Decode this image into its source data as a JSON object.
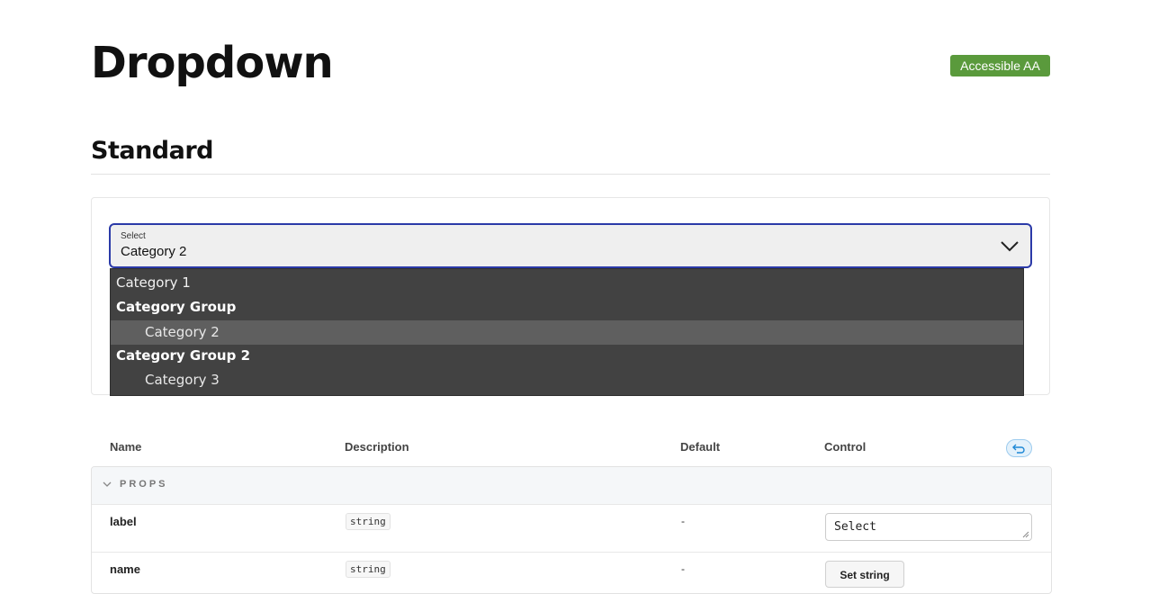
{
  "page": {
    "title": "Dropdown",
    "badge": "Accessible AA",
    "section_title": "Standard"
  },
  "select": {
    "label": "Select",
    "value": "Category 2",
    "options": [
      {
        "label": "Category 1",
        "kind": "option"
      },
      {
        "label": "Category Group",
        "kind": "group"
      },
      {
        "label": "Category 2",
        "kind": "child",
        "selected": true
      },
      {
        "label": "Category Group 2",
        "kind": "group"
      },
      {
        "label": "Category 3",
        "kind": "child"
      }
    ]
  },
  "table": {
    "headers": {
      "name": "Name",
      "description": "Description",
      "default": "Default",
      "control": "Control"
    },
    "group_label": "PROPS",
    "rows": [
      {
        "name": "label",
        "type": "string",
        "default": "-",
        "control_value": "Select"
      },
      {
        "name": "name",
        "type": "string",
        "default": "-",
        "control_button": "Set string"
      }
    ]
  },
  "colors": {
    "accent_border": "#2b3aa8",
    "badge_bg": "#5a9a3c",
    "menu_bg": "#424242",
    "menu_selected": "#5f5f5f"
  },
  "icons": {
    "select_chevron": "chevron-down-icon",
    "reset": "undo-icon",
    "props_toggle": "chevron-down-icon"
  }
}
